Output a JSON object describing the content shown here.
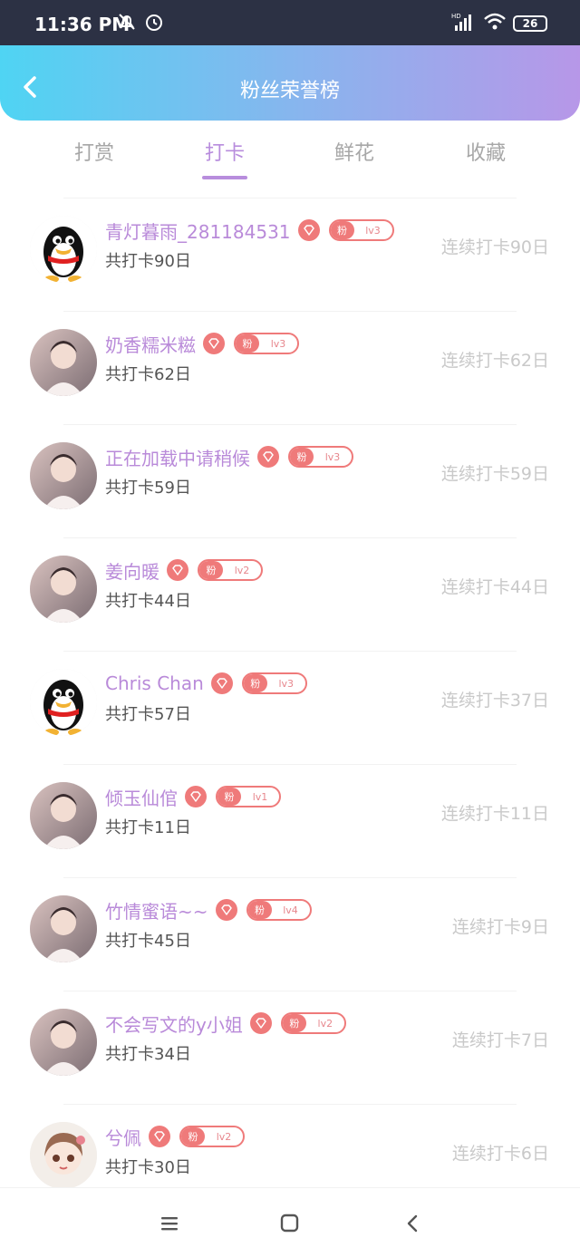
{
  "status_bar": {
    "time": "11:36 PM",
    "battery": "26",
    "network": "HD"
  },
  "header": {
    "title": "粉丝荣誉榜"
  },
  "tabs": [
    {
      "label": "打赏"
    },
    {
      "label": "打卡"
    },
    {
      "label": "鲜花"
    },
    {
      "label": "收藏"
    }
  ],
  "active_tab": "打卡",
  "users": [
    {
      "name": "青灯暮雨_281184531",
      "badge_prefix": "粉",
      "level": "lv3",
      "total": "共打卡90日",
      "streak": "连续打卡90日",
      "avatar": "penguin-avatar"
    },
    {
      "name": "奶香糯米糍",
      "badge_prefix": "粉",
      "level": "lv3",
      "total": "共打卡62日",
      "streak": "连续打卡62日",
      "avatar": "photo-avatar"
    },
    {
      "name": "正在加载中请稍候",
      "badge_prefix": "粉",
      "level": "lv3",
      "total": "共打卡59日",
      "streak": "连续打卡59日",
      "avatar": "photo-avatar"
    },
    {
      "name": "姜向暖",
      "badge_prefix": "粉",
      "level": "lv2",
      "total": "共打卡44日",
      "streak": "连续打卡44日",
      "avatar": "photo-avatar"
    },
    {
      "name": "Chris Chan",
      "badge_prefix": "粉",
      "level": "lv3",
      "total": "共打卡57日",
      "streak": "连续打卡37日",
      "avatar": "penguin-avatar"
    },
    {
      "name": "倾玉仙倌",
      "badge_prefix": "粉",
      "level": "lv1",
      "total": "共打卡11日",
      "streak": "连续打卡11日",
      "avatar": "photo-avatar"
    },
    {
      "name": "竹情蜜语~~",
      "badge_prefix": "粉",
      "level": "lv4",
      "total": "共打卡45日",
      "streak": "连续打卡9日",
      "avatar": "photo-avatar"
    },
    {
      "name": "不会写文的y小姐",
      "badge_prefix": "粉",
      "level": "lv2",
      "total": "共打卡34日",
      "streak": "连续打卡7日",
      "avatar": "photo-avatar"
    },
    {
      "name": "兮佩",
      "badge_prefix": "粉",
      "level": "lv2",
      "total": "共打卡30日",
      "streak": "连续打卡6日",
      "avatar": "anime-avatar"
    }
  ],
  "colors": {
    "header_gradient": [
      "#4fd4f3",
      "#b797e8"
    ],
    "accent": "#b88ddd",
    "badge": "#ef7a7a"
  }
}
